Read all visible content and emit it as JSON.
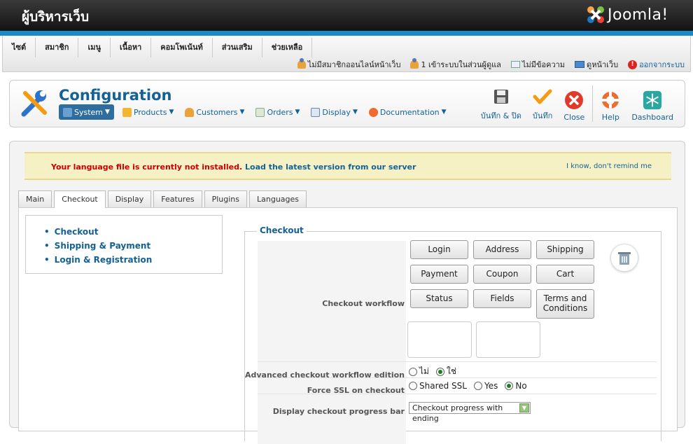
{
  "header": {
    "site_title": "ผู้บริหารเว็บ",
    "brand": "Joomla!"
  },
  "mainmenu": [
    "ไซต์",
    "สมาชิก",
    "เมนู",
    "เนื้อหา",
    "คอมโพเน้นท์",
    "ส่วนเสริม",
    "ช่วยเหลือ"
  ],
  "statusbar": {
    "online_users": "ไม่มีสมาชิกออนไลน์หน้าเว็บ",
    "admins": "1 เข้าระบบในส่วนผู้ดูแล",
    "messages": "ไม่มีข้อความ",
    "view_site": "ดูหน้าเว็บ",
    "logout": "ออกจากระบบ"
  },
  "toolbar": {
    "title": "Configuration",
    "submenu": [
      "System",
      "Products",
      "Customers",
      "Orders",
      "Display",
      "Documentation"
    ],
    "save_close": "บันทึก & ปิด",
    "save": "บันทึก",
    "close": "Close",
    "help": "Help",
    "dashboard": "Dashboard"
  },
  "notice": {
    "warning": "Your language file is currently not installed.",
    "link": "Load the latest version from our server",
    "dismiss": "I know, don't remind me"
  },
  "tabs": [
    "Main",
    "Checkout",
    "Display",
    "Features",
    "Plugins",
    "Languages"
  ],
  "active_tab": "Checkout",
  "sidenav": [
    "Checkout",
    "Shipping & Payment",
    "Login & Registration"
  ],
  "checkout": {
    "legend": "Checkout",
    "workflow_label": "Checkout workflow",
    "workflow_buttons": [
      "Login",
      "Address",
      "Shipping",
      "Payment",
      "Coupon",
      "Cart",
      "Status",
      "Fields",
      "Terms and Conditions"
    ],
    "advanced_label": "Advanced checkout workflow edition",
    "advanced_options": [
      "ไม่",
      "ใช่"
    ],
    "advanced_selected": "ใช่",
    "ssl_label": "Force SSL on checkout",
    "ssl_options": [
      "Shared SSL",
      "Yes",
      "No"
    ],
    "ssl_selected": "No",
    "progress_label": "Display checkout progress bar",
    "progress_value": "Checkout progress with ending"
  },
  "colors": {
    "header_dark": "#1a1a1a",
    "header_blue": "#1b88c8",
    "link_blue": "#146295",
    "notice_red": "#cc0000",
    "notice_bg": "#f6f0c5"
  }
}
